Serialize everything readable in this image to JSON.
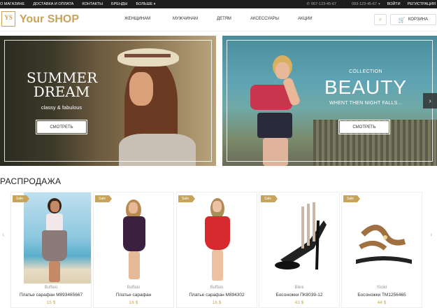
{
  "topbar": {
    "links": [
      "О МАГАЗИНЕ",
      "ДОСТАВКА И ОПЛАТА",
      "КОНТАКТЫ",
      "БРЕНДЫ",
      "БОЛЬШЕ"
    ],
    "phone1": "067-123-45-67",
    "phone2": "093-123-45-67",
    "login": "ВОЙТИ",
    "register": "РЕГИСТРАЦИЯ"
  },
  "header": {
    "logo_mark": "YS",
    "logo_text": "Your SHOP",
    "nav": [
      "ЖЕНЩИНАМ",
      "МУЖЧИНАМ",
      "ДЕТЯМ",
      "АКСЕССУАРЫ",
      "АКЦИИ"
    ],
    "cart_label": "КОРЗИНА",
    "icons": {
      "search": "search-icon",
      "cart": "cart-icon",
      "phone": "phone-icon"
    }
  },
  "banners": [
    {
      "title": "SUMMER DREAM",
      "subtitle": "classy & fabulous",
      "button": "СМОТРЕТЬ"
    },
    {
      "pre": "COLLECTION",
      "title": "BEAUTY",
      "subtitle": "WHENT THEN NIGHT FALLS...",
      "button": "СМОТРЕТЬ"
    }
  ],
  "sale": {
    "title": "РАСПРОДАЖА",
    "badge": "Sale",
    "products": [
      {
        "brand": "Buffalo",
        "name": "Платье сарафан M893465667",
        "price": "15 $"
      },
      {
        "brand": "Buffalo",
        "name": "Платье сарафан",
        "price": "16 $"
      },
      {
        "brand": "Buffalo",
        "name": "Платье сарафан M894302",
        "price": "16 $"
      },
      {
        "brand": "Blink",
        "name": "Босоножки ПК8039-12",
        "price": "41 $"
      },
      {
        "brand": "!Solid",
        "name": "Босоножки TM1256465",
        "price": "44 $"
      }
    ]
  },
  "colors": {
    "accent": "#c8a45a",
    "topbar": "#1d1d1d"
  }
}
